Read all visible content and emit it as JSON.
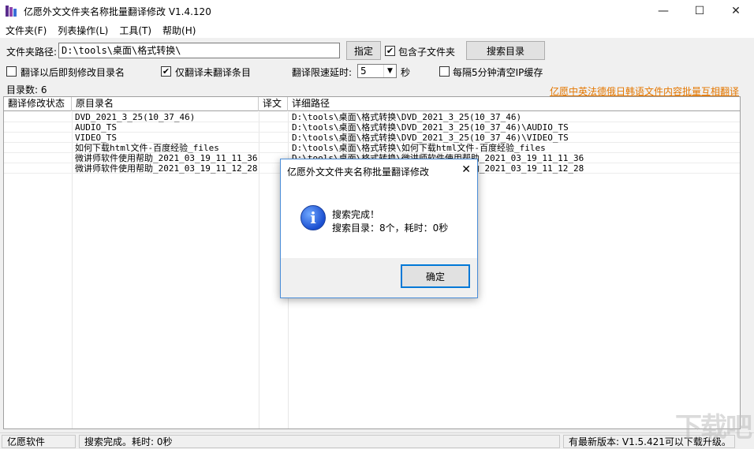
{
  "window": {
    "title": "亿愿外文文件夹名称批量翻译修改 V1.4.120",
    "minimize": "—",
    "maximize": "☐",
    "close": "✕"
  },
  "menu": {
    "items": [
      "文件夹(F)",
      "列表操作(L)",
      "工具(T)",
      "帮助(H)"
    ]
  },
  "toolbar": {
    "folder_label": "文件夹路径:",
    "folder_value": "D:\\tools\\桌面\\格式转换\\",
    "specify_button": "指定",
    "include_subfolders_label": "包含子文件夹",
    "include_subfolders_checked": true,
    "search_button": "搜索目录",
    "rename_after_label": "翻译以后即刻修改目录名",
    "rename_after_checked": false,
    "only_untranslated_label": "仅翻译未翻译条目",
    "only_untranslated_checked": true,
    "delay_label": "翻译限速延时:",
    "delay_value": "5",
    "delay_unit": "秒",
    "clear_ip_label": "每隔5分钟清空IP缓存",
    "clear_ip_checked": false,
    "dir_count_label": "目录数: 6",
    "promo_link": "亿愿中英法德俄日韩语文件内容批量互相翻译"
  },
  "table": {
    "headers": [
      "翻译修改状态",
      "原目录名",
      "译文",
      "详细路径"
    ],
    "rows": [
      {
        "status": "",
        "name": "DVD_2021_3_25(10_37_46)",
        "translation": "",
        "path": "D:\\tools\\桌面\\格式转换\\DVD_2021_3_25(10_37_46)"
      },
      {
        "status": "",
        "name": "AUDIO_TS",
        "translation": "",
        "path": "D:\\tools\\桌面\\格式转换\\DVD_2021_3_25(10_37_46)\\AUDIO_TS"
      },
      {
        "status": "",
        "name": "VIDEO_TS",
        "translation": "",
        "path": "D:\\tools\\桌面\\格式转换\\DVD_2021_3_25(10_37_46)\\VIDEO_TS"
      },
      {
        "status": "",
        "name": "如何下载html文件-百度经验_files",
        "translation": "",
        "path": "D:\\tools\\桌面\\格式转换\\如何下载html文件-百度经验_files"
      },
      {
        "status": "",
        "name": "微讲师软件使用帮助_2021_03_19_11_11_36",
        "translation": "",
        "path": "D:\\tools\\桌面\\格式转换\\微讲师软件使用帮助_2021_03_19_11_11_36"
      },
      {
        "status": "",
        "name": "微讲师软件使用帮助_2021_03_19_11_12_28",
        "translation": "",
        "path": "D:\\tools\\桌面\\格式转换\\微讲师软件使用帮助_2021_03_19_11_12_28"
      }
    ]
  },
  "statusbar": {
    "company": "亿愿软件",
    "message": "搜索完成。耗时: 0秒",
    "update": "有最新版本: V1.5.421可以下载升级。"
  },
  "dialog": {
    "title": "亿愿外文文件夹名称批量翻译修改",
    "close": "✕",
    "icon": "info-icon",
    "line1": "搜索完成！",
    "line2": "搜索目录：8个，耗时：0秒",
    "ok_button": "确定"
  },
  "watermark": "下载吧",
  "colors": {
    "accent": "#0078d7",
    "promo_link": "#e47700",
    "info_blue": "#1b4fd0"
  }
}
